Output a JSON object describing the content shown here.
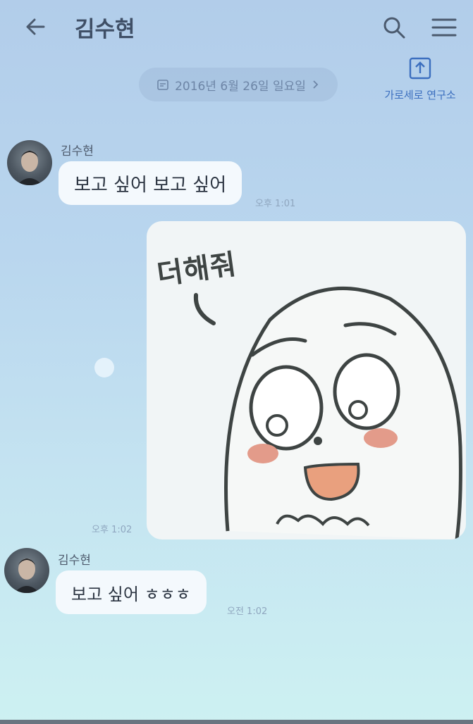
{
  "header": {
    "title": "김수현",
    "back_icon": "arrow-left-icon",
    "search_icon": "search-icon",
    "menu_icon": "menu-icon"
  },
  "date_divider": {
    "label": "2016년 6월 26일 일요일",
    "icon": "calendar-icon",
    "chevron": "chevron-right-icon"
  },
  "side_widget": {
    "label": "가로세로 연구소",
    "icon": "upload-icon"
  },
  "messages": [
    {
      "sender": "김수현",
      "text": "보고 싶어 보고 싶어",
      "time": "오후 1:01"
    },
    {
      "type": "sticker",
      "sticker_text": "더해줘",
      "time": "오후 1:02"
    },
    {
      "sender": "김수현",
      "text": "보고 싶어 ㅎㅎㅎ",
      "time": "오전 1:02"
    }
  ],
  "colors": {
    "accent": "#3c6fbf",
    "bubble": "#f4f9fd",
    "cheek": "#e39b8a"
  }
}
